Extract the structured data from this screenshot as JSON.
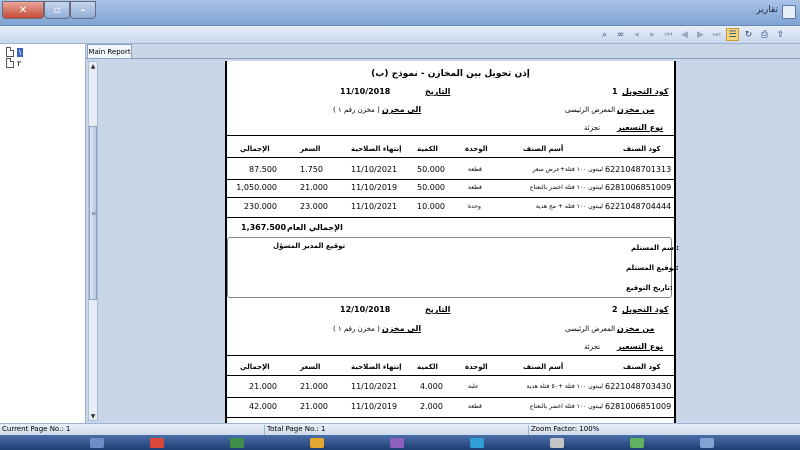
{
  "window": {
    "title": "تقارير",
    "close_glyph": "✕"
  },
  "toolbar": {
    "icons": [
      "find-icon",
      "binoculars-icon",
      "prev-page-icon",
      "next-page-icon",
      "first-page-icon",
      "back-icon",
      "forward-icon",
      "last-page-icon",
      "tree-toggle-icon",
      "refresh-icon",
      "print-icon",
      "export-icon"
    ]
  },
  "tree": {
    "items": [
      "١",
      "٢"
    ]
  },
  "tab": {
    "label": "Main Report"
  },
  "report": {
    "title": "إذن تحويل بين المخازن - نموذج (ب)",
    "labels": {
      "transfer_code": "كود التحويل",
      "date": "التاريخ",
      "from_store": "من مخزن",
      "to_store": "الى مخزن",
      "pricing_type": "نوع التسعير",
      "grand_total": "الإجمالي العام",
      "receiver_name": "اسم المستلم:",
      "receiver_signature": "توقيع المستلم:",
      "signature_date": "تاريخ التوقيع:",
      "manager_signature": "توقيع المدير المسؤل"
    },
    "columns": {
      "item_code": "كود الصنف",
      "item_name": "أسم الصنف",
      "unit": "الوحدة",
      "qty": "الكمية",
      "expiry": "إنتهاء الصلاحية",
      "price": "السعر",
      "total": "الإجمالي"
    },
    "transfers": [
      {
        "code": "1",
        "date": "11/10/2018",
        "from_store": "المعرض الرئيسى",
        "to_store": "( مخزن رقم ١ )",
        "pricing": "تجزئة",
        "rows": [
          {
            "code": "6221048701313",
            "name": "ليبتون ١٠٠ فتلة+عرض سعر",
            "unit": "قطعة",
            "qty": "50.000",
            "expiry": "11/10/2021",
            "price": "1.750",
            "total": "87.500"
          },
          {
            "code": "6281006851009",
            "name": "ليبتون ١٠٠ فتلة اخضر بالنعناع",
            "unit": "قطعة",
            "qty": "50.000",
            "expiry": "11/10/2019",
            "price": "21.000",
            "total": "1,050.000"
          },
          {
            "code": "6221048704444",
            "name": "ليبتون ١٠٠ فتله + مج هدية",
            "unit": "وحدة",
            "qty": "10.000",
            "expiry": "11/10/2021",
            "price": "23.000",
            "total": "230.000"
          }
        ],
        "grand_total": "1,367.500"
      },
      {
        "code": "2",
        "date": "12/10/2018",
        "from_store": "المعرض الرئيسى",
        "to_store": "( مخزن رقم ١ )",
        "pricing": "تجزئة",
        "rows": [
          {
            "code": "6221048703430",
            "name": "ليبتون ١٠٠ فتلة +٥٠ فتلة هدية",
            "unit": "علبة",
            "qty": "4.000",
            "expiry": "11/10/2021",
            "price": "21.000",
            "total": "21.000"
          },
          {
            "code": "6281006851009",
            "name": "ليبتون ١٠٠ فتلة اخضر بالنعناع",
            "unit": "قطعة",
            "qty": "2.000",
            "expiry": "11/10/2019",
            "price": "21.000",
            "total": "42.000"
          }
        ]
      }
    ]
  },
  "status": {
    "current_page": "Current Page No.: 1",
    "total_page": "Total Page No.: 1",
    "zoom": "Zoom Factor: 100%"
  },
  "colors": {
    "accent": "#3a64c4",
    "titlebar": "#7fa3d3",
    "taskbar": "#1f3e72"
  }
}
